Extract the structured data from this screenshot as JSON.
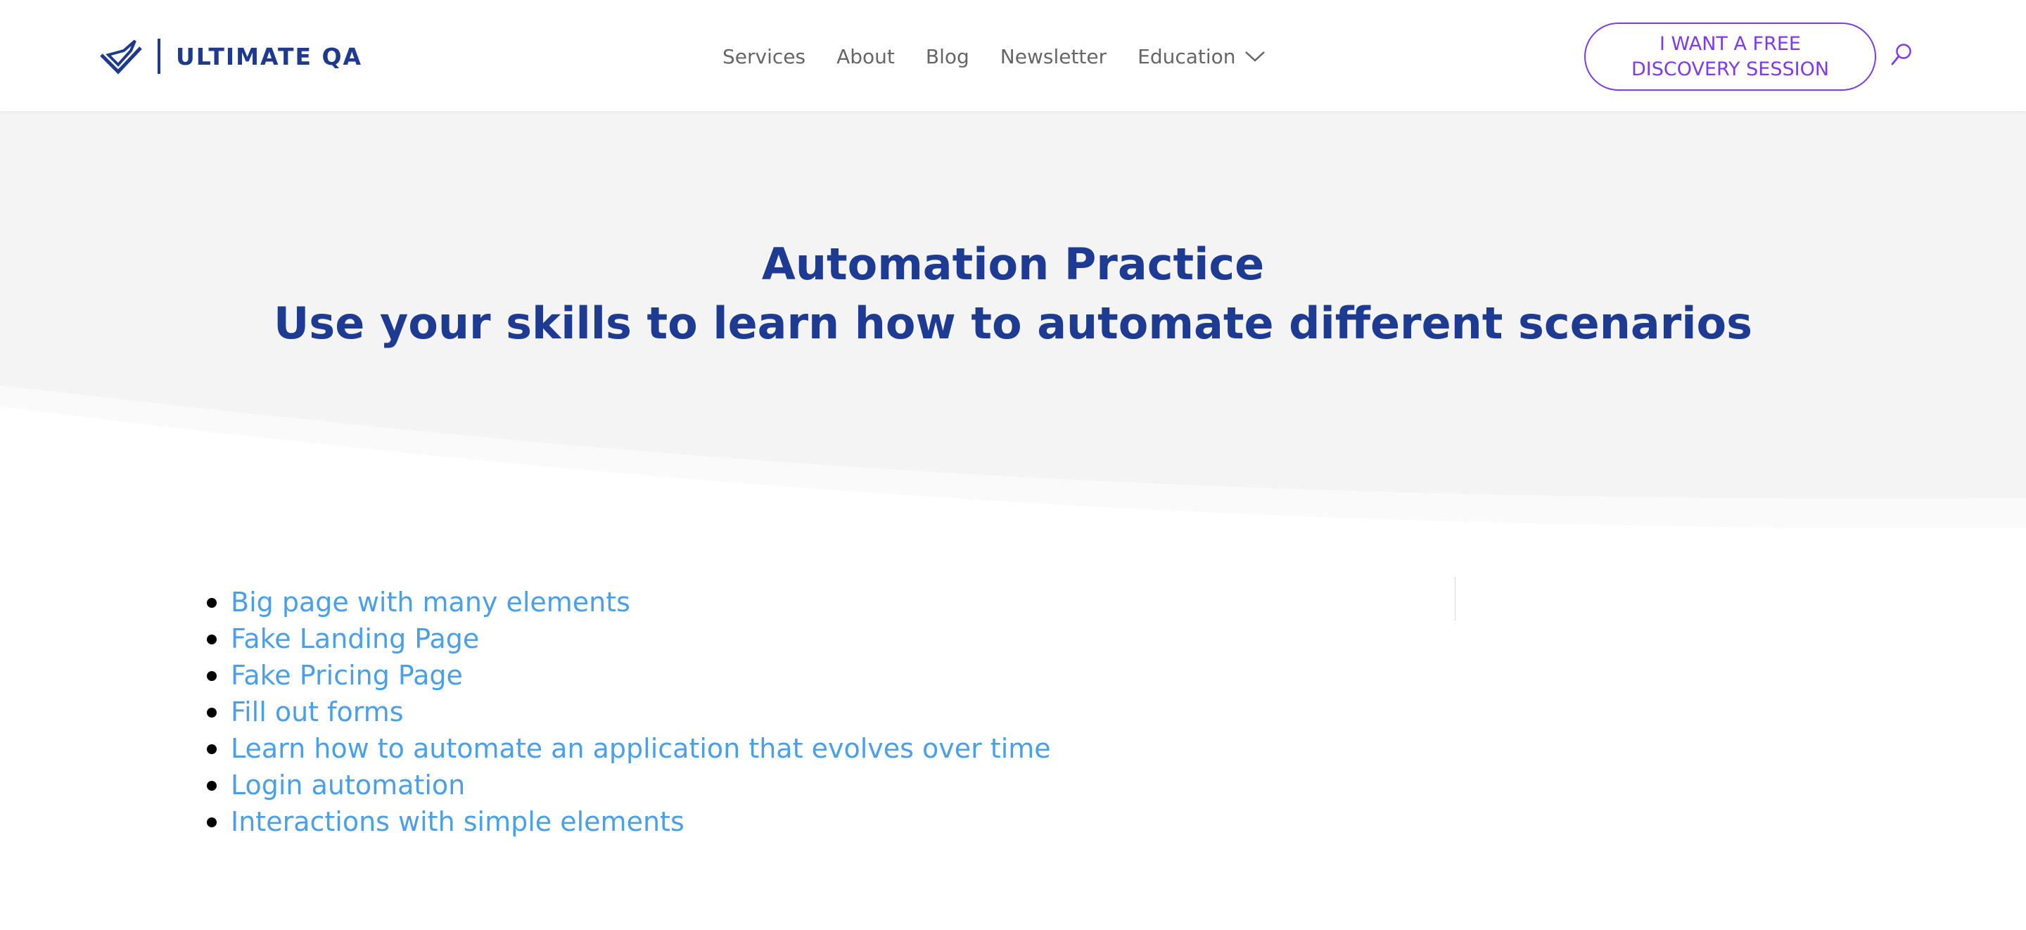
{
  "header": {
    "logo_text": "ULTIMATE QA",
    "nav": [
      {
        "label": "Services"
      },
      {
        "label": "About"
      },
      {
        "label": "Blog"
      },
      {
        "label": "Newsletter"
      },
      {
        "label": "Education",
        "has_dropdown": true
      }
    ],
    "cta": {
      "line1": "I WANT A FREE",
      "line2": "DISCOVERY SESSION"
    },
    "search_icon": "search-icon"
  },
  "hero": {
    "title": "Automation Practice",
    "subtitle": "Use your skills to learn how to automate different scenarios"
  },
  "links": [
    {
      "label": "Big page with many elements"
    },
    {
      "label": "Fake Landing Page"
    },
    {
      "label": "Fake Pricing Page"
    },
    {
      "label": "Fill out forms"
    },
    {
      "label": "Learn how to automate an application that evolves over time"
    },
    {
      "label": "Login automation"
    },
    {
      "label": "Interactions with simple elements"
    }
  ],
  "colors": {
    "brand_navy": "#1d3a8f",
    "heading": "#1e3b94",
    "link": "#4a9fe8",
    "cta": "#7c3aed",
    "hero_bg": "#f4f4f4",
    "nav_text": "#666666"
  }
}
